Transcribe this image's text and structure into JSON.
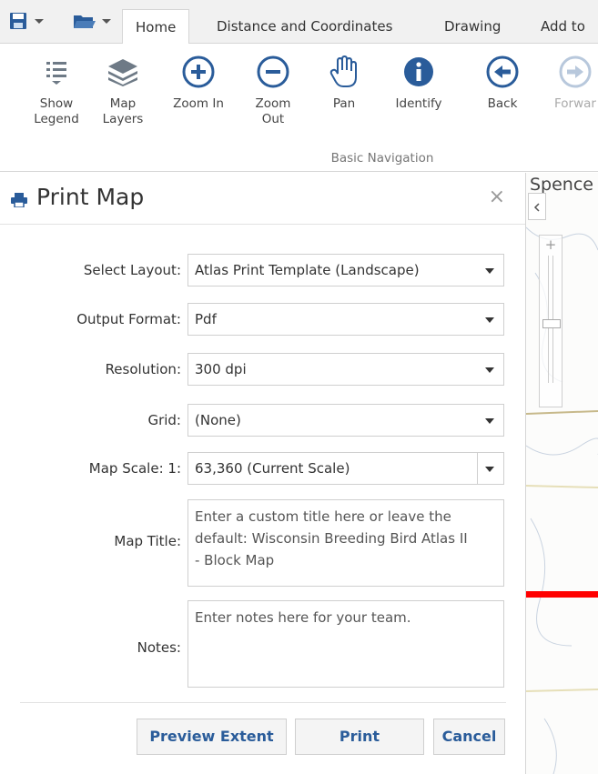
{
  "tabs": [
    {
      "label": "Home",
      "active": true
    },
    {
      "label": "Distance and Coordinates",
      "active": false
    },
    {
      "label": "Drawing",
      "active": false
    },
    {
      "label": "Add to",
      "active": false
    }
  ],
  "ribbon": {
    "buttons": [
      {
        "line1": "Show",
        "line2": "Legend",
        "icon": "legend-list-icon"
      },
      {
        "line1": "Map",
        "line2": "Layers",
        "icon": "layers-icon"
      },
      {
        "line1": "Zoom In",
        "line2": "",
        "icon": "zoom-in-icon"
      },
      {
        "line1": "Zoom Out",
        "line2": "",
        "icon": "zoom-out-icon"
      },
      {
        "line1": "Pan",
        "line2": "",
        "icon": "hand-icon"
      },
      {
        "line1": "Identify",
        "line2": "",
        "icon": "info-icon"
      },
      {
        "line1": "Back",
        "line2": "",
        "icon": "back-arrow-icon"
      },
      {
        "line1": "Forwar",
        "line2": "",
        "icon": "forward-arrow-icon"
      }
    ],
    "group_label": "Basic Navigation"
  },
  "panel": {
    "title": "Print Map",
    "close": "×",
    "fields": {
      "layout": {
        "label": "Select Layout:",
        "value": "Atlas Print Template (Landscape)"
      },
      "format": {
        "label": "Output Format:",
        "value": "Pdf"
      },
      "resolution": {
        "label": "Resolution:",
        "value": "300 dpi"
      },
      "grid": {
        "label": "Grid:",
        "value": "(None)"
      },
      "scale": {
        "label": "Map Scale: 1:",
        "value": "63,360 (Current Scale)"
      },
      "title": {
        "label": "Map Title:",
        "line1": "Enter a custom title here or leave the",
        "line2": "default: Wisconsin Breeding Bird Atlas II",
        "line3": "- Block Map"
      },
      "notes": {
        "label": "Notes:",
        "placeholder": "Enter notes here for your team."
      }
    },
    "buttons": {
      "preview": "Preview Extent",
      "print": "Print",
      "cancel": "Cancel"
    }
  },
  "map": {
    "label": "Spence",
    "zoom_plus": "+",
    "accent": "#ff0000"
  },
  "colors": {
    "icon_blue": "#2a5c9a",
    "icon_gray": "#6e7a86"
  }
}
